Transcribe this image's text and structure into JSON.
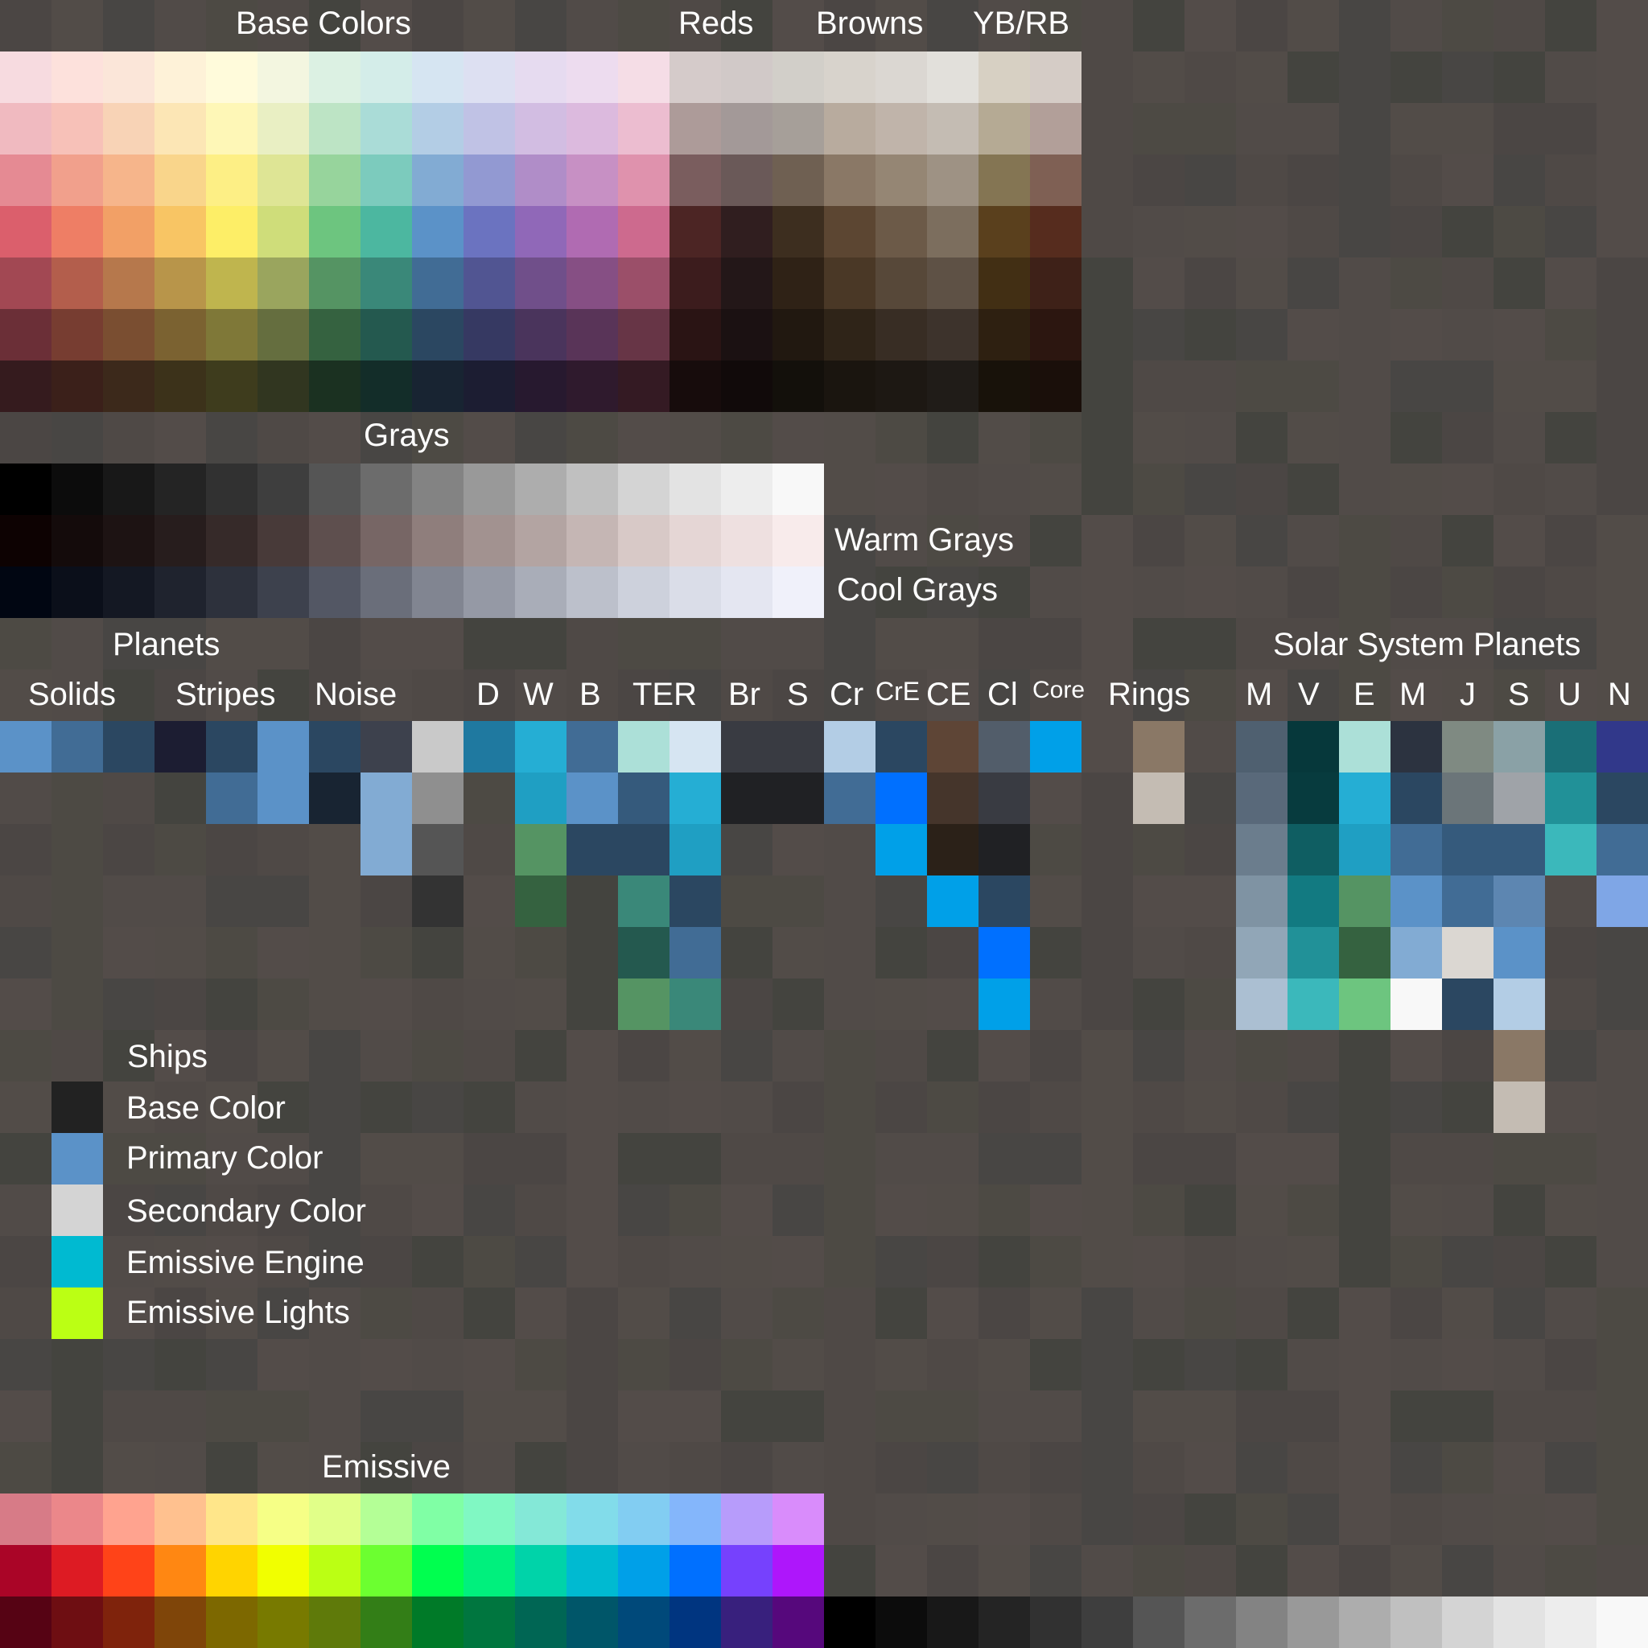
{
  "colors": {
    "bg": [
      "#4b4644",
      "#514b48",
      "#44443f",
      "#524c48",
      "#4d4a44",
      "#534c49",
      "#484644",
      "#4f4946"
    ]
  },
  "labels": {
    "base_colors": "Base Colors",
    "reds": "Reds",
    "browns": "Browns",
    "yb_rb": "YB/RB",
    "grays": "Grays",
    "warm_grays": "Warm Grays",
    "cool_grays": "Cool Grays",
    "planets": "Planets",
    "solids": "Solids",
    "stripes": "Stripes",
    "noise": "Noise",
    "d": "D",
    "w": "W",
    "b": "B",
    "ter": "TER",
    "br": "Br",
    "s": "S",
    "cr": "Cr",
    "cre": "CrE",
    "ce": "CE",
    "cl": "Cl",
    "core": "Core",
    "rings": "Rings",
    "solar_system_planets": "Solar System Planets",
    "sp": [
      "M",
      "V",
      "E",
      "M",
      "J",
      "S",
      "U",
      "N"
    ],
    "ships": "Ships",
    "base_color": "Base Color",
    "primary_color": "Primary Color",
    "secondary_color": "Secondary Color",
    "emissive_engine": "Emissive Engine",
    "emissive_lights": "Emissive Lights",
    "emissive": "Emissive"
  },
  "palette": {
    "base_colors": [
      [
        "#f7dbe0",
        "#fde1dc",
        "#fbe6d9",
        "#fef2d8",
        "#fffbdb",
        "#f3f6e0",
        "#dcf1e3",
        "#d4ede9",
        "#d6e5f2",
        "#dde0f2",
        "#e6dbf0",
        "#eddcef",
        "#f5dde6"
      ],
      [
        "#f0bac0",
        "#f7c1b8",
        "#f8d3b6",
        "#fce6b5",
        "#fef7b7",
        "#e9efc3",
        "#bde4c5",
        "#aadcd7",
        "#b3cde5",
        "#c0c2e5",
        "#d2bde2",
        "#dcbade",
        "#ecbdd0"
      ],
      [
        "#e58a93",
        "#f1a08c",
        "#f6b58b",
        "#f9d58b",
        "#fdef85",
        "#dee595",
        "#97d49c",
        "#7ccbbd",
        "#82abd3",
        "#9299d2",
        "#b08dc8",
        "#c790c4",
        "#df92ad"
      ],
      [
        "#db5f6c",
        "#ee7e65",
        "#f2a066",
        "#f8c564",
        "#fdee67",
        "#cfdd7a",
        "#6dc57f",
        "#4cb7a0",
        "#5b92c8",
        "#6b73c0",
        "#9068b8",
        "#b06bb2",
        "#cd6a8e"
      ],
      [
        "#a24853",
        "#b35e4c",
        "#b6784c",
        "#b8954a",
        "#bfb54e",
        "#9aa55e",
        "#559463",
        "#3a8879",
        "#416c95",
        "#515592",
        "#704f8a",
        "#864f84",
        "#9b4f69"
      ],
      [
        "#6b2f37",
        "#773d31",
        "#7a4e31",
        "#7b6231",
        "#7f7838",
        "#656e3f",
        "#356240",
        "#24594f",
        "#2b4761",
        "#363962",
        "#4a345c",
        "#593458",
        "#673546"
      ],
      [
        "#351b1e",
        "#3b201a",
        "#3c291b",
        "#3c321a",
        "#3e3c1d",
        "#313620",
        "#1b3121",
        "#132d29",
        "#182432",
        "#1c1d32",
        "#27192f",
        "#2f1a2d",
        "#341a23"
      ]
    ],
    "reds_browns": [
      [
        "#d5cbca",
        "#d1c9c8",
        "#d2cfc9",
        "#d8d3cc",
        "#dbd7d2",
        "#e2e0db",
        "#d7d0c3",
        "#d5ccc6"
      ],
      [
        "#ad9b99",
        "#a39998",
        "#a69f99",
        "#b8ab9e",
        "#c0b4aa",
        "#c4bcb3",
        "#b5aa94",
        "#b29f99"
      ],
      [
        "#7a5d5e",
        "#6a5958",
        "#6f6052",
        "#8a7866",
        "#958674",
        "#9e9284",
        "#847553",
        "#7f6054"
      ],
      [
        "#4c2524",
        "#301e1f",
        "#3d2e1f",
        "#5c4632",
        "#6c5a48",
        "#7c6e5e",
        "#5a401d",
        "#562c1e"
      ],
      [
        "#3c1c1d",
        "#231718",
        "#2f2216",
        "#4a3826",
        "#574839",
        "#5e5145",
        "#422f14",
        "#3e2118"
      ],
      [
        "#2a1414",
        "#1b1112",
        "#211810",
        "#2f2418",
        "#382d24",
        "#3d332c",
        "#2e2011",
        "#2c1610"
      ],
      [
        "#170c0c",
        "#110a0a",
        "#13100b",
        "#1a150f",
        "#1d1813",
        "#201c18",
        "#18120a",
        "#1a0f0a"
      ]
    ],
    "grays": [
      "#000000",
      "#0c0c0c",
      "#181818",
      "#242424",
      "#313131",
      "#3e3e3e",
      "#555555",
      "#6c6c6c",
      "#838383",
      "#999999",
      "#adadad",
      "#c0c0c0",
      "#d4d4d4",
      "#e3e3e3",
      "#ededed",
      "#f8f8f8"
    ],
    "warm_grays": [
      "#0d0202",
      "#140b0b",
      "#1d1313",
      "#271d1d",
      "#362a29",
      "#483a39",
      "#5e4f4e",
      "#776665",
      "#8f7e7c",
      "#a29290",
      "#b3a4a2",
      "#c5b6b4",
      "#d8c9c7",
      "#e5d6d5",
      "#eee0e0",
      "#f8ebeb"
    ],
    "cool_grays": [
      "#010612",
      "#0b0f1a",
      "#141823",
      "#1f232e",
      "#2d313c",
      "#3d414d",
      "#535764",
      "#6a6e7a",
      "#818591",
      "#9599a5",
      "#a9adb8",
      "#bcc0cb",
      "#cdd1dc",
      "#dadde8",
      "#e4e6f1",
      "#f0f1fa"
    ],
    "emissive": [
      [
        "#d77b87",
        "#eb878a",
        "#ffa38f",
        "#ffc18f",
        "#ffe68a",
        "#f6ff86",
        "#e1ff89",
        "#b4ff96",
        "#80ffa5",
        "#80f8c3",
        "#84e8d7",
        "#82dcea",
        "#82cdf2",
        "#84b6fb",
        "#b79cfb",
        "#d98cfb"
      ],
      [
        "#aa0527",
        "#dd1b23",
        "#ff4318",
        "#ff8712",
        "#ffd400",
        "#f1ff00",
        "#bbff14",
        "#6cff30",
        "#00ff4f",
        "#00f07d",
        "#00d3a9",
        "#00bad1",
        "#00a0e8",
        "#0070ff",
        "#7641fd",
        "#ae16fb"
      ],
      [
        "#560314",
        "#6e0e12",
        "#7f230c",
        "#7f4509",
        "#7d6800",
        "#787a00",
        "#5f7a0a",
        "#337e17",
        "#007a28",
        "#00763f",
        "#006654",
        "#005669",
        "#00497a",
        "#003580",
        "#38207d",
        "#56087c"
      ]
    ],
    "bottom_grays": [
      "#000000",
      "#0c0c0c",
      "#181818",
      "#242424",
      "#313131",
      "#3e3e3e",
      "#555555",
      "#6c6c6c",
      "#838383",
      "#999999",
      "#adadad",
      "#c0c0c0",
      "#d4d4d4",
      "#e3e3e3",
      "#ededed",
      "#f8f8f8"
    ],
    "planets": [
      {
        "col": 0,
        "colors": [
          "#5b92c8"
        ]
      },
      {
        "col": 1,
        "colors": [
          "#416c95"
        ]
      },
      {
        "col": 2,
        "colors": [
          "#2b4761"
        ]
      },
      {
        "col": 3,
        "colors": [
          "#1c1d32"
        ]
      },
      {
        "col": 4,
        "colors": [
          "#2b4761",
          "#416c95"
        ]
      },
      {
        "col": 5,
        "colors": [
          "#5b92c8",
          "#5b92c8"
        ]
      },
      {
        "col": 6,
        "colors": [
          "#2b4761",
          "#182432"
        ]
      },
      {
        "col": 7,
        "colors": [
          "#3d414d",
          "#82abd3",
          "#82abd3"
        ]
      },
      {
        "col": 8,
        "colors": [
          "#c9c9c9",
          "#8f8f8f",
          "#555555",
          "#333333"
        ]
      },
      {
        "col": 9,
        "colors": [
          "#1f79a0"
        ]
      },
      {
        "col": 10,
        "colors": [
          "#25aed4",
          "#1f9fc3",
          "#559463",
          "#356240"
        ]
      },
      {
        "col": 11,
        "colors": [
          "#416c95",
          "#5b92c8",
          "#2b4761"
        ]
      },
      {
        "col": 12,
        "colors": [
          "#ace0d8",
          "#355a7c",
          "#2b4761",
          "#3a8879",
          "#24594f",
          "#559463"
        ]
      },
      {
        "col": 13,
        "colors": [
          "#d6e5f2",
          "#25aed4",
          "#1f9fc3",
          "#2b4761",
          "#416c95",
          "#3a8879"
        ]
      },
      {
        "col": 14,
        "colors": [
          "#393b42",
          "#202124"
        ]
      },
      {
        "col": 15,
        "colors": [
          "#393b42",
          "#202124"
        ]
      },
      {
        "col": 16,
        "colors": [
          "#b3cde5",
          "#416c95"
        ]
      },
      {
        "col": 17,
        "colors": [
          "#2b4761",
          "#0070ff",
          "#00a0e8"
        ]
      },
      {
        "col": 18,
        "colors": [
          "#5e4536",
          "#45352b",
          "#2b2118",
          "#00a0e8"
        ]
      },
      {
        "col": 19,
        "colors": [
          "#525d6a",
          "#393b42",
          "#202124",
          "#2b4761",
          "#0070ff",
          "#00a0e8"
        ]
      },
      {
        "col": 20,
        "colors": [
          "#00a0e8"
        ]
      },
      {
        "col": 22,
        "colors": [
          "#8a7866",
          "#c4bcb3"
        ]
      }
    ],
    "solar_planets": [
      [
        "#4f6070",
        "#59697a",
        "#6b7d8d",
        "#7f93a3",
        "#91a6b7",
        "#abbfd2"
      ],
      [
        "#06383b",
        "#073b3e",
        "#0f5e62",
        "#127a81",
        "#219198",
        "#3bb8bb"
      ],
      [
        "#ace0d8",
        "#25aed4",
        "#1f9fc3",
        "#559463",
        "#356240",
        "#6dc57f"
      ],
      [
        "#2c3340",
        "#2b4761",
        "#416c95",
        "#5b92c8",
        "#82abd3",
        "#f8f8f8"
      ],
      [
        "#7f8a82",
        "#6b7579",
        "#355a7c",
        "#416c95",
        "#dbd7d2",
        "#2b4761"
      ],
      [
        "#8aa1a6",
        "#9fa3a8",
        "#355a7c",
        "#5d86b1",
        "#5b92c8",
        "#b3cde5",
        "#8a7866",
        "#c4bcb3"
      ],
      [
        "#1a6f77",
        "#219198",
        "#3bb8bb"
      ],
      [
        "#31388a",
        "#2b4761",
        "#416c95",
        "#7fa6e6"
      ]
    ],
    "ships": [
      "#222222",
      "#5b92c8",
      "#d4d4d4",
      "#00bad1",
      "#bbff14"
    ]
  }
}
